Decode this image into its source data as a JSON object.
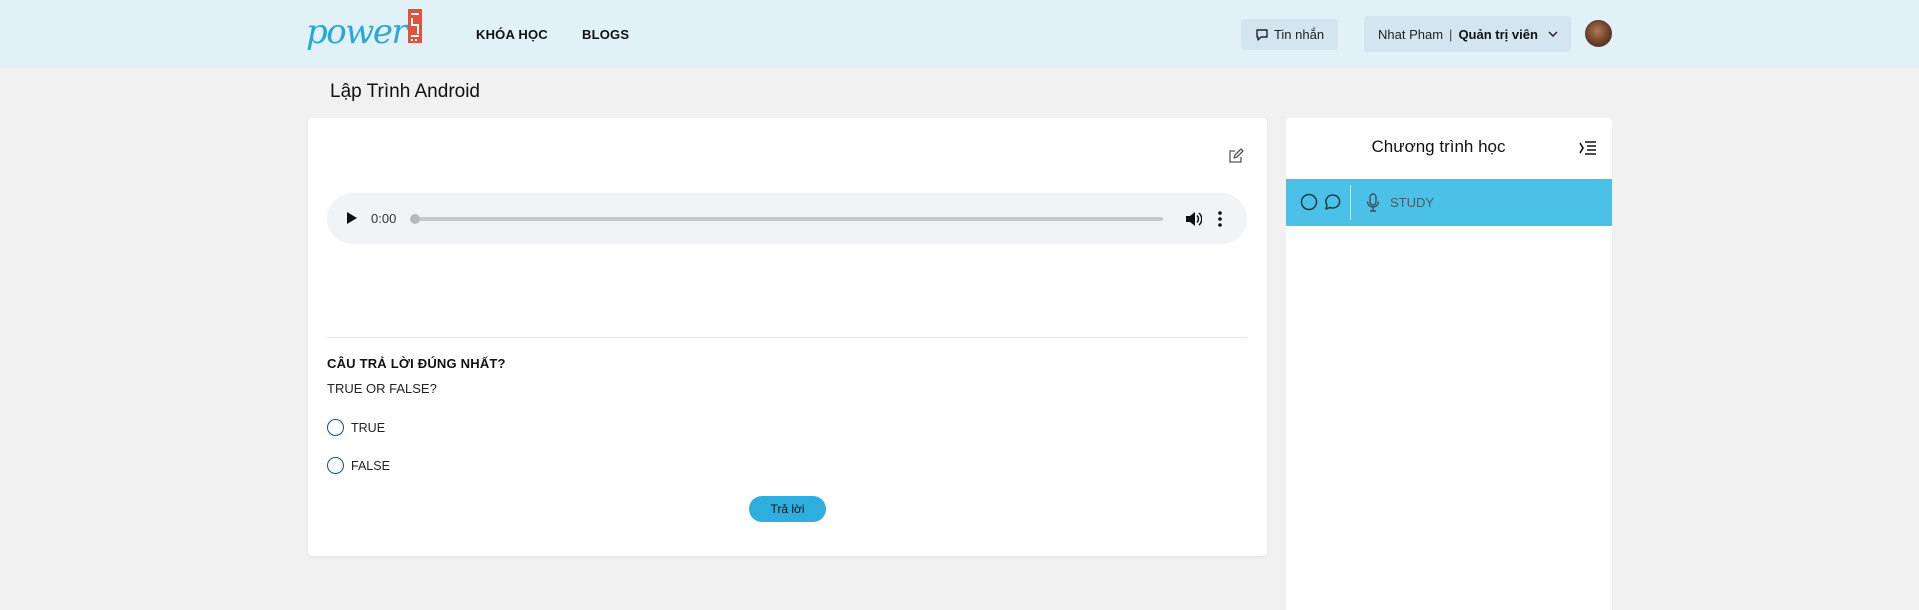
{
  "header": {
    "logo_text": "power",
    "nav": [
      "KHÓA HỌC",
      "BLOGS"
    ],
    "messages_label": "Tin nhắn",
    "user_name": "Nhat Pham",
    "user_separator": "|",
    "user_role": "Quản trị viên",
    "colors": {
      "background": "#e0f1f8",
      "brand": "#29a8d8",
      "brand_mark": "#e0523a"
    }
  },
  "page": {
    "title": "Lập Trình Android"
  },
  "lesson": {
    "audio": {
      "time": "0:00"
    },
    "question_heading": "CÂU TRẢ LỜI ĐÚNG NHẤT?",
    "question_text": "TRUE OR FALSE?",
    "options": [
      "TRUE",
      "FALSE"
    ],
    "submit_label": "Trả lời",
    "colors": {
      "submit": "#2eaede"
    }
  },
  "sidebar": {
    "title": "Chương trình học",
    "items": [
      {
        "label": "STUDY",
        "icon": "microphone-icon",
        "active": true
      }
    ],
    "colors": {
      "active_item": "#4cc1e7"
    }
  }
}
